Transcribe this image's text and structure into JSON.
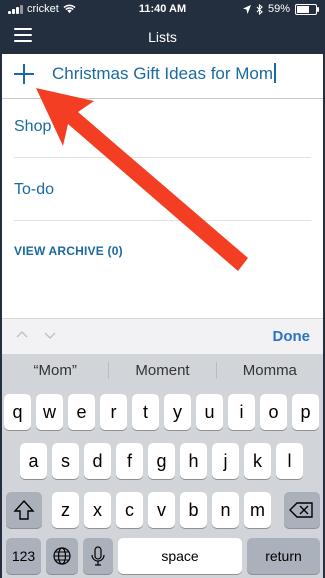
{
  "status_bar": {
    "carrier": "cricket",
    "time": "11:40 AM",
    "battery_percent": "59%",
    "battery_level": 0.59
  },
  "nav": {
    "title": "Lists"
  },
  "new_list": {
    "value": "Christmas Gift Ideas for Mom"
  },
  "lists": {
    "items": [
      {
        "label": "Shop"
      },
      {
        "label": "To-do"
      }
    ],
    "archive_label": "VIEW ARCHIVE (0)"
  },
  "keyboard_toolbar": {
    "done_label": "Done"
  },
  "keyboard": {
    "suggestions": [
      "“Mom”",
      "Moment",
      "Momma"
    ],
    "row1": [
      "q",
      "w",
      "e",
      "r",
      "t",
      "y",
      "u",
      "i",
      "o",
      "p"
    ],
    "row2": [
      "a",
      "s",
      "d",
      "f",
      "g",
      "h",
      "j",
      "k",
      "l"
    ],
    "row3": [
      "z",
      "x",
      "c",
      "v",
      "b",
      "n",
      "m"
    ],
    "numbers_label": "123",
    "space_label": "space",
    "return_label": "return"
  },
  "colors": {
    "brand_bar": "#232f3e",
    "accent": "#1a6aa0",
    "arrow": "#f33e24"
  },
  "icons": [
    "wifi-icon",
    "location-icon",
    "bluetooth-icon",
    "battery-icon",
    "menu-icon",
    "add-icon",
    "chevron-up-icon",
    "chevron-down-icon",
    "shift-icon",
    "backspace-icon",
    "globe-icon",
    "microphone-icon"
  ]
}
